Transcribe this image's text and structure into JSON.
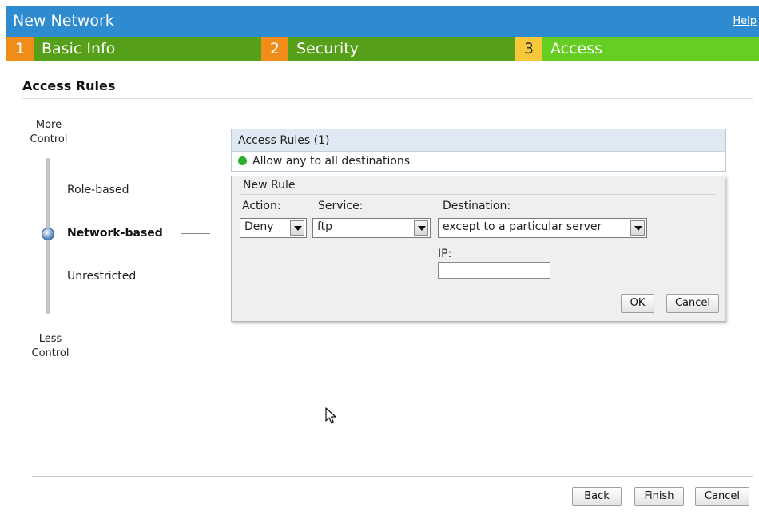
{
  "header": {
    "title": "New Network",
    "help_label": "Help"
  },
  "steps": [
    {
      "num": "1",
      "label": "Basic Info"
    },
    {
      "num": "2",
      "label": "Security"
    },
    {
      "num": "3",
      "label": "Access"
    }
  ],
  "section_title": "Access Rules",
  "slider": {
    "top_label_line1": "More",
    "top_label_line2": "Control",
    "bottom_label_line1": "Less",
    "bottom_label_line2": "Control",
    "options": [
      "Role-based",
      "Network-based",
      "Unrestricted"
    ],
    "selected": "Network-based"
  },
  "rules": {
    "header": "Access Rules (1)",
    "items": [
      "Allow any to all destinations"
    ]
  },
  "new_rule": {
    "title": "New Rule",
    "action_label": "Action:",
    "action_value": "Deny",
    "service_label": "Service:",
    "service_value": "ftp",
    "destination_label": "Destination:",
    "destination_value": "except to a particular server",
    "ip_label": "IP:",
    "ip_value": "",
    "ok_label": "OK",
    "cancel_label": "Cancel"
  },
  "footer": {
    "back_label": "Back",
    "finish_label": "Finish",
    "cancel_label": "Cancel"
  },
  "colors": {
    "header_blue": "#2e8bd0",
    "step_green": "#55a018",
    "step_active_green": "#66cd22",
    "step_num_orange": "#f08c1a",
    "step_num_active": "#f7c93a",
    "status_green": "#2db02d"
  },
  "icons": {
    "cursor": "mouse-pointer-icon",
    "status": "green-dot-icon",
    "dropdown": "dropdown-arrow-icon"
  }
}
